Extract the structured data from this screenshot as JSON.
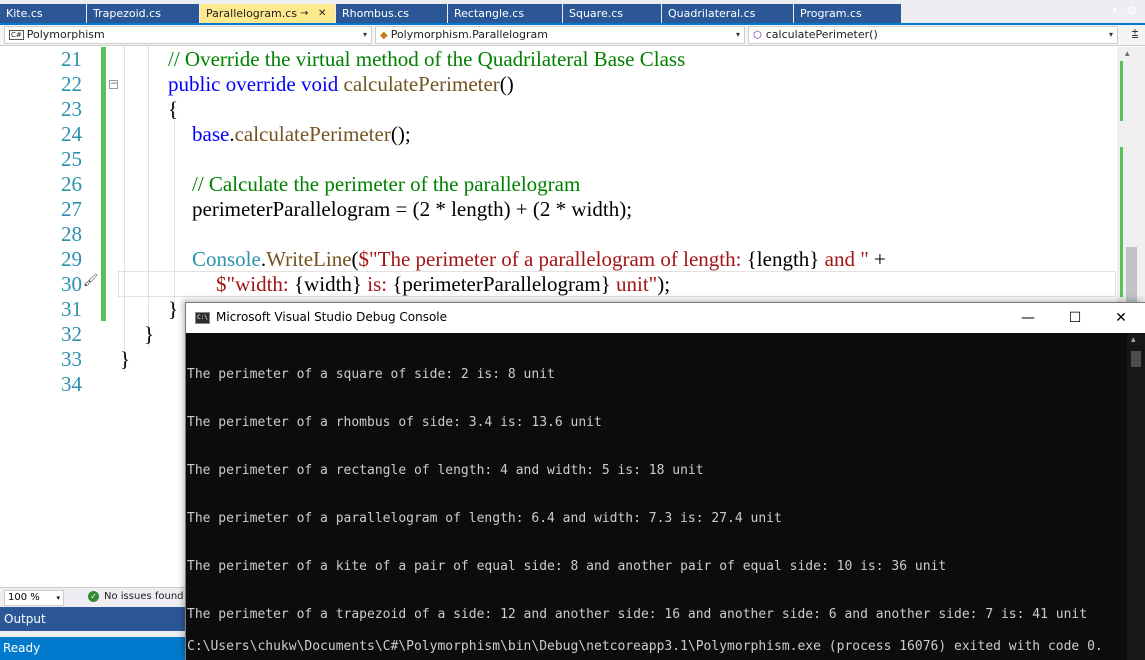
{
  "tabs": [
    {
      "label": "Kite.cs",
      "active": false
    },
    {
      "label": "Trapezoid.cs",
      "active": false
    },
    {
      "label": "Parallelogram.cs",
      "active": true
    },
    {
      "label": "Rhombus.cs",
      "active": false
    },
    {
      "label": "Rectangle.cs",
      "active": false
    },
    {
      "label": "Square.cs",
      "active": false
    },
    {
      "label": "Quadrilateral.cs",
      "active": false
    },
    {
      "label": "Program.cs",
      "active": false
    }
  ],
  "tab_icons": {
    "pin": "→",
    "close": "✕",
    "dropdown": "▾",
    "gear": "⚙"
  },
  "navbar": {
    "project": "Polymorphism",
    "type": "Polymorphism.Parallelogram",
    "member": "calculatePerimeter()",
    "project_badge": "C#",
    "arrow": "▾",
    "split": "⩲"
  },
  "editor": {
    "line_numbers": [
      "21",
      "22",
      "23",
      "24",
      "25",
      "26",
      "27",
      "28",
      "29",
      "30",
      "31",
      "32",
      "33",
      "34"
    ],
    "code": {
      "l21": "// Override the virtual method of the Quadrilateral Base Class",
      "l22_kw": "public override void ",
      "l22_method": "calculatePerimeter",
      "l22_tail": "()",
      "l23": "{",
      "l24_kw": "base",
      "l24_dot": ".",
      "l24_method": "calculatePerimeter",
      "l24_tail": "();",
      "l26": "// Calculate the perimeter of the parallelogram",
      "l27": "perimeterParallelogram = (2 * length) + (2 * width);",
      "l29_type": "Console",
      "l29_dot": ".",
      "l29_method": "WriteLine",
      "l29_paren": "(",
      "l29_str1": "$\"The perimeter of a parallelogram of length: ",
      "l29_interp": "{length}",
      "l29_str2": " and \"",
      "l29_plus": " +",
      "l30_str1": "$\"width: ",
      "l30_interp1": "{width}",
      "l30_str2": " is: ",
      "l30_interp2": "{perimeterParallelogram}",
      "l30_str3": " unit\"",
      "l30_tail": ");",
      "l31": "}",
      "l32": "}",
      "l33": "}"
    },
    "collapse_glyph": "−",
    "quick_action_icon": "🖌"
  },
  "editor_status": {
    "zoom": "100 %",
    "issues": "No issues found",
    "ok_glyph": "✓",
    "arrow": "▾"
  },
  "output_pane": {
    "title": "Output"
  },
  "statusbar": {
    "text": "Ready"
  },
  "console": {
    "title": "Microsoft Visual Studio Debug Console",
    "icon_text": "C:\\",
    "buttons": {
      "minimize": "—",
      "maximize": "☐",
      "close": "✕"
    },
    "scroll_up": "▴",
    "lines": [
      "The perimeter of a square of side: 2 is: 8 unit",
      "The perimeter of a rhombus of side: 3.4 is: 13.6 unit",
      "The perimeter of a rectangle of length: 4 and width: 5 is: 18 unit",
      "The perimeter of a parallelogram of length: 6.4 and width: 7.3 is: 27.4 unit",
      "The perimeter of a kite of a pair of equal side: 8 and another pair of equal side: 10 is: 36 unit",
      "The perimeter of a trapezoid of a side: 12 and another side: 16 and another side: 6 and another side: 7 is: 41 unit",
      "C:\\Users\\chukw\\Documents\\C#\\Polymorphism\\bin\\Debug\\netcoreapp3.1\\Polymorphism.exe (process 16076) exited with code 0."
    ]
  },
  "colors": {
    "accent": "#007acc",
    "tab_inactive": "#2b5797",
    "tab_active": "#ffe98f",
    "line_number": "#2b91af",
    "keyword": "#0000ff",
    "comment": "#008000",
    "string": "#a31515",
    "change_bar": "#57c25a"
  }
}
